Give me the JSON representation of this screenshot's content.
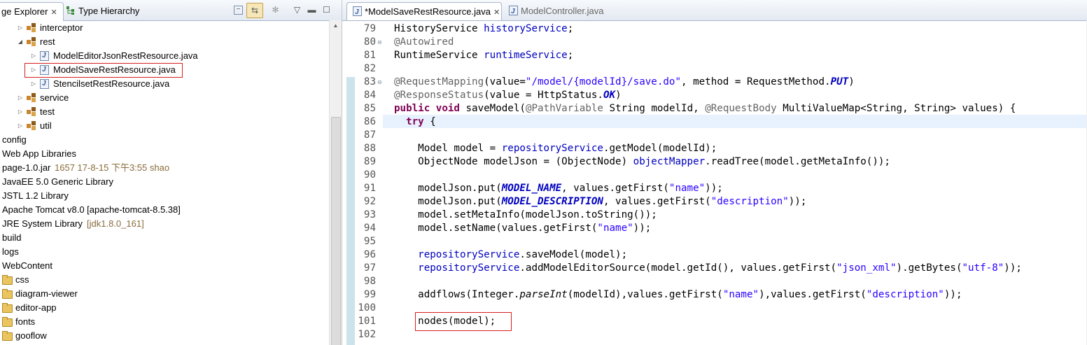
{
  "left_panel": {
    "tab_package_explorer": "ge Explorer",
    "tab_type_hierarchy": "Type Hierarchy",
    "tree": [
      {
        "label": "interceptor",
        "kind": "package",
        "arrow": "▷"
      },
      {
        "label": "rest",
        "kind": "package",
        "arrow": "◢"
      },
      {
        "label": "ModelEditorJsonRestResource.java",
        "kind": "java",
        "arrow": "▷"
      },
      {
        "label": "ModelSaveRestResource.java",
        "kind": "java",
        "arrow": "▷"
      },
      {
        "label": "StencilsetRestResource.java",
        "kind": "java",
        "arrow": "▷"
      },
      {
        "label": "service",
        "kind": "package",
        "arrow": "▷"
      },
      {
        "label": "test",
        "kind": "package",
        "arrow": "▷"
      },
      {
        "label": "util",
        "kind": "package",
        "arrow": "▷"
      },
      {
        "label": "config",
        "kind": "plain"
      },
      {
        "label": "Web App Libraries",
        "kind": "plain"
      },
      {
        "label": "page-1.0.jar",
        "extra": "1657  17-8-15 下午3:55  shao",
        "kind": "plain"
      },
      {
        "label": "JavaEE 5.0 Generic Library",
        "kind": "plain"
      },
      {
        "label": "JSTL 1.2 Library",
        "kind": "plain"
      },
      {
        "label": "Apache Tomcat v8.0 [apache-tomcat-8.5.38]",
        "kind": "plain"
      },
      {
        "label": "JRE System Library",
        "extra": "[jdk1.8.0_161]",
        "kind": "plain"
      },
      {
        "label": "build",
        "kind": "plain"
      },
      {
        "label": "logs",
        "kind": "plain"
      },
      {
        "label": "WebContent",
        "kind": "plain"
      },
      {
        "label": "css",
        "kind": "folder"
      },
      {
        "label": "diagram-viewer",
        "kind": "folder"
      },
      {
        "label": "editor-app",
        "kind": "folder"
      },
      {
        "label": "fonts",
        "kind": "folder"
      },
      {
        "label": "gooflow",
        "kind": "folder"
      }
    ]
  },
  "editor": {
    "active_tab": "*ModelSaveRestResource.java",
    "other_tab": "ModelController.java",
    "line_numbers": [
      "79",
      "80",
      "81",
      "82",
      "83",
      "84",
      "85",
      "86",
      "87",
      "88",
      "89",
      "90",
      "91",
      "92",
      "93",
      "94",
      "95",
      "96",
      "97",
      "98",
      "99",
      "100",
      "101",
      "102"
    ],
    "code_lines": [
      [
        {
          "t": "HistoryService "
        },
        {
          "t": "historyService",
          "c": "fld"
        },
        {
          "t": ";"
        }
      ],
      [
        {
          "t": "@Autowired",
          "c": "ann"
        }
      ],
      [
        {
          "t": "RuntimeService "
        },
        {
          "t": "runtimeService",
          "c": "fld"
        },
        {
          "t": ";"
        }
      ],
      [],
      [
        {
          "t": "@RequestMapping",
          "c": "ann"
        },
        {
          "t": "(value="
        },
        {
          "t": "\"/model/{modelId}/save.do\"",
          "c": "str"
        },
        {
          "t": ", method = RequestMethod."
        },
        {
          "t": "PUT",
          "c": "stfld"
        },
        {
          "t": ")"
        }
      ],
      [
        {
          "t": "@ResponseStatus",
          "c": "ann"
        },
        {
          "t": "(value = HttpStatus."
        },
        {
          "t": "OK",
          "c": "stfld"
        },
        {
          "t": ")"
        }
      ],
      [
        {
          "t": "public",
          "c": "kw"
        },
        {
          "t": " "
        },
        {
          "t": "void",
          "c": "kw"
        },
        {
          "t": " saveModel("
        },
        {
          "t": "@PathVariable",
          "c": "ann"
        },
        {
          "t": " String modelId, "
        },
        {
          "t": "@RequestBody",
          "c": "ann"
        },
        {
          "t": " MultiValueMap<String, String> values) {"
        }
      ],
      [
        {
          "t": "  "
        },
        {
          "t": "try",
          "c": "kw"
        },
        {
          "t": " {"
        }
      ],
      [],
      [
        {
          "t": "    Model model = "
        },
        {
          "t": "repositoryService",
          "c": "fld"
        },
        {
          "t": ".getModel(modelId);"
        }
      ],
      [
        {
          "t": "    ObjectNode modelJson = (ObjectNode) "
        },
        {
          "t": "objectMapper",
          "c": "fld"
        },
        {
          "t": ".readTree(model.getMetaInfo());"
        }
      ],
      [],
      [
        {
          "t": "    modelJson.put("
        },
        {
          "t": "MODEL_NAME",
          "c": "stfld"
        },
        {
          "t": ", values.getFirst("
        },
        {
          "t": "\"name\"",
          "c": "str"
        },
        {
          "t": "));"
        }
      ],
      [
        {
          "t": "    modelJson.put("
        },
        {
          "t": "MODEL_DESCRIPTION",
          "c": "stfld"
        },
        {
          "t": ", values.getFirst("
        },
        {
          "t": "\"description\"",
          "c": "str"
        },
        {
          "t": "));"
        }
      ],
      [
        {
          "t": "    model.setMetaInfo(modelJson.toString());"
        }
      ],
      [
        {
          "t": "    model.setName(values.getFirst("
        },
        {
          "t": "\"name\"",
          "c": "str"
        },
        {
          "t": "));"
        }
      ],
      [],
      [
        {
          "t": "    "
        },
        {
          "t": "repositoryService",
          "c": "fld"
        },
        {
          "t": ".saveModel(model);"
        }
      ],
      [
        {
          "t": "    "
        },
        {
          "t": "repositoryService",
          "c": "fld"
        },
        {
          "t": ".addModelEditorSource(model.getId(), values.getFirst("
        },
        {
          "t": "\"json_xml\"",
          "c": "str"
        },
        {
          "t": ").getBytes("
        },
        {
          "t": "\"utf-8\"",
          "c": "str"
        },
        {
          "t": "));"
        }
      ],
      [],
      [
        {
          "t": "    addflows(Integer."
        },
        {
          "t": "parseInt",
          "c": "itm"
        },
        {
          "t": "(modelId),values.getFirst("
        },
        {
          "t": "\"name\"",
          "c": "str"
        },
        {
          "t": "),values.getFirst("
        },
        {
          "t": "\"description\"",
          "c": "str"
        },
        {
          "t": "));"
        }
      ],
      [],
      [
        {
          "t": "    nodes(model);"
        }
      ],
      []
    ]
  },
  "colors": {
    "keyword": "#7f0055",
    "field": "#0000c0",
    "string": "#2a00ff",
    "annotation": "#646464",
    "highlight_box": "#d61f1f",
    "current_line": "#e8f2fe"
  }
}
